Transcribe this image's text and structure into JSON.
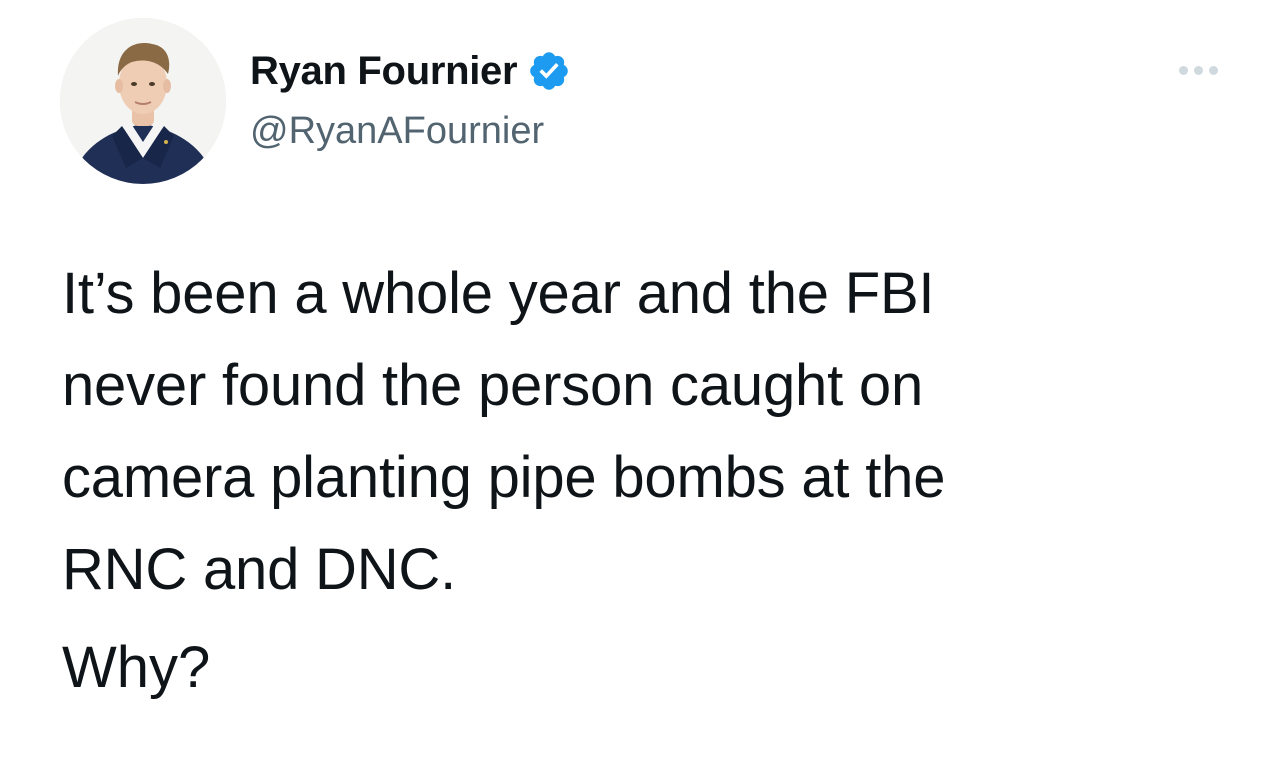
{
  "author": {
    "display_name": "Ryan Fournier",
    "handle": "@RyanAFournier",
    "verified": true,
    "avatar_icon": "profile-photo"
  },
  "menu": {
    "icon": "more-horizontal-icon"
  },
  "tweet": {
    "lines": [
      "It’s been a whole year and the FBI",
      "never found the person caught on",
      "camera planting pipe bombs at the",
      "RNC and DNC."
    ],
    "second_paragraph": "Why?"
  },
  "colors": {
    "text": "#0f1419",
    "secondary_text": "#536471",
    "verified_badge": "#1d9bf0",
    "more_dots": "#cfd9de",
    "background": "#ffffff"
  }
}
